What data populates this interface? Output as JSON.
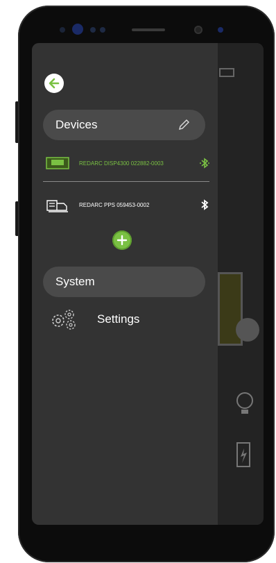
{
  "drawer": {
    "back_icon": "arrow-left-icon",
    "devices_header": "Devices",
    "edit_icon": "pencil-icon",
    "devices": [
      {
        "name": "REDARC DISP4300 022882-0003",
        "icon": "display-device-icon",
        "status_icon": "bluetooth-icon",
        "color": "#7ac143"
      },
      {
        "name": "REDARC PPS 059453-0002",
        "icon": "power-pack-icon",
        "status_icon": "bluetooth-icon",
        "color": "#ffffff"
      }
    ],
    "add_icon": "plus-icon",
    "system_header": "System",
    "settings_label": "Settings",
    "settings_icon": "gears-icon"
  },
  "colors": {
    "accent": "#7ac143",
    "drawer_bg": "#333333",
    "pill_bg": "#4a4a4a"
  }
}
